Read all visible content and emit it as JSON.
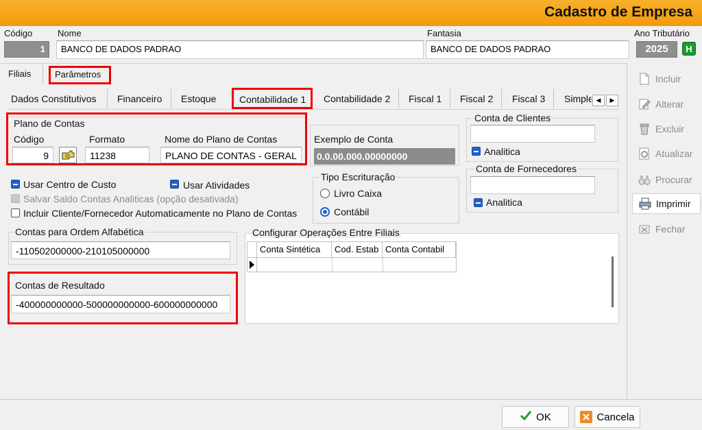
{
  "title": "Cadastro de Empresa",
  "header": {
    "codigo_label": "Código",
    "codigo_value": "1",
    "nome_label": "Nome",
    "nome_value": "BANCO DE DADOS PADRAO",
    "fantasia_label": "Fantasia",
    "fantasia_value": "BANCO DE DADOS PADRAO",
    "ano_label": "Ano Tributário",
    "ano_value": "2025",
    "ano_badge": "H"
  },
  "main_tabs": [
    "Filiais",
    "Parâmetros"
  ],
  "sub_tabs": [
    "Dados  Constitutivos",
    "Financeiro",
    "Estoque",
    "Contabilidade 1",
    "Contabilidade 2",
    "Fiscal 1",
    "Fiscal 2",
    "Fiscal 3",
    "Simple"
  ],
  "plano": {
    "group_label": "Plano de Contas",
    "codigo_label": "Código",
    "codigo_value": "9",
    "formato_label": "Formato",
    "formato_value": "11238",
    "nome_label": "Nome do Plano de Contas",
    "nome_value": "PLANO DE CONTAS - GERAL",
    "exemplo_label": "Exemplo de Conta",
    "exemplo_value": "0.0.00.000.00000000"
  },
  "options": {
    "centro_custo": "Usar Centro de Custo",
    "atividades": "Usar Atividades",
    "salvar_saldo": "Salvar Saldo  Contas Analiticas (opção desativada)",
    "incluir_cliente": "Incluir Cliente/Fornecedor Automaticamente no Plano de Contas"
  },
  "tipo_escrituracao": {
    "label": "Tipo Escrituração",
    "livro_caixa": "Livro Caixa",
    "contabil": "Contábil"
  },
  "clientes": {
    "label": "Conta de Clientes",
    "value": "",
    "analitica": "Analitica"
  },
  "fornecedores": {
    "label": "Conta de Fornecedores",
    "value": "",
    "analitica": "Analitica"
  },
  "ordem_alfabetica": {
    "label": "Contas para Ordem  Alfabética",
    "value": "-110502000000-210105000000"
  },
  "resultado": {
    "label": "Contas de Resultado",
    "value": "-400000000000-500000000000-600000000000"
  },
  "operacoes": {
    "label": "Configurar Operações Entre Filiais",
    "columns": [
      "Conta Sintética",
      "Cod. Estab",
      "Conta Contabil"
    ]
  },
  "side_buttons": [
    "Incluir",
    "Alterar",
    "Excluir",
    "Atualizar",
    "Procurar",
    "Imprimir",
    "Fechar"
  ],
  "footer": {
    "ok": "OK",
    "cancel": "Cancela"
  },
  "colors": {
    "title_bar": "#f39a0c",
    "highlight": "#e00000",
    "checkbox": "#1f61c9"
  }
}
